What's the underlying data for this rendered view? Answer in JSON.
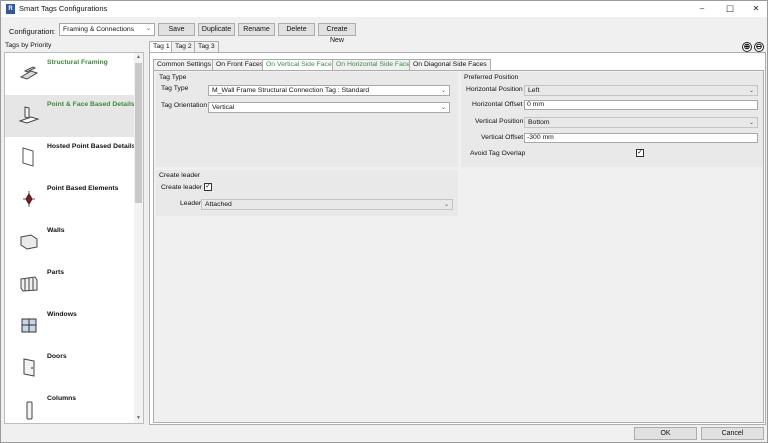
{
  "window": {
    "title": "Smart Tags Configurations",
    "app_icon_letter": "R",
    "minimize": "–",
    "maximize": "☐",
    "close": "✕"
  },
  "toolbar": {
    "configuration_label": "Configuration",
    "colon": ":",
    "configuration_value": "Framing & Connections",
    "save": "Save",
    "duplicate": "Duplicate",
    "rename": "Rename",
    "delete": "Delete",
    "create_new": "Create New"
  },
  "sidebar": {
    "header": "Tags by Priority",
    "items": [
      {
        "label": "Structural Framing",
        "icon": "structural-framing-icon",
        "selected": false,
        "highlight": true
      },
      {
        "label": "Point & Face Based Details",
        "icon": "detail-icon",
        "selected": true,
        "highlight": true
      },
      {
        "label": "Hosted Point Based Details",
        "icon": "hosted-detail-icon",
        "selected": false,
        "highlight": false
      },
      {
        "label": "Point Based Elements",
        "icon": "point-element-icon",
        "selected": false,
        "highlight": false
      },
      {
        "label": "Walls",
        "icon": "wall-icon",
        "selected": false,
        "highlight": false
      },
      {
        "label": "Parts",
        "icon": "parts-icon",
        "selected": false,
        "highlight": false
      },
      {
        "label": "Windows",
        "icon": "window-icon",
        "selected": false,
        "highlight": false
      },
      {
        "label": "Doors",
        "icon": "door-icon",
        "selected": false,
        "highlight": false
      },
      {
        "label": "Columns",
        "icon": "column-icon",
        "selected": false,
        "highlight": false
      }
    ]
  },
  "tag_tabs": [
    "Tag 1",
    "Tag 2",
    "Tag 3"
  ],
  "add_icon": "⊕",
  "remove_icon": "⊖",
  "face_tabs": [
    "Common Settings",
    "On Front Faces",
    "On Vertical Side Faces",
    "On Horizontal Side Faces",
    "On Diagonal Side Faces"
  ],
  "tag_type_group": {
    "title": "Tag Type",
    "tag_type_label": "Tag Type",
    "tag_type_value": "M_Wall Frame Structural Connection Tag : Standard",
    "orientation_label": "Tag Orientation",
    "orientation_value": "Vertical"
  },
  "preferred_position_group": {
    "title": "Preferred Position",
    "horizontal_position_label": "Horizontal Position",
    "horizontal_position_value": "Left",
    "horizontal_offset_label": "Horizontal Offset",
    "horizontal_offset_value": "0 mm",
    "vertical_position_label": "Vertical Position",
    "vertical_position_value": "Bottom",
    "vertical_offset_label": "Vertical Offset",
    "vertical_offset_value": "-300 mm",
    "avoid_overlap_label": "Avoid Tag Overlap",
    "avoid_overlap_checked": true
  },
  "create_leader_group": {
    "title": "Create leader",
    "create_leader_label": "Create leader",
    "create_leader_checked": true,
    "leader_label": "Leader",
    "leader_value": "Attached"
  },
  "check_mark": "✓",
  "dropdown_arrow": "⌄",
  "footer": {
    "ok": "OK",
    "cancel": "Cancel"
  },
  "colors": {
    "accent_green": "#3c8c3c",
    "selected_bg": "#e6e6e6"
  }
}
